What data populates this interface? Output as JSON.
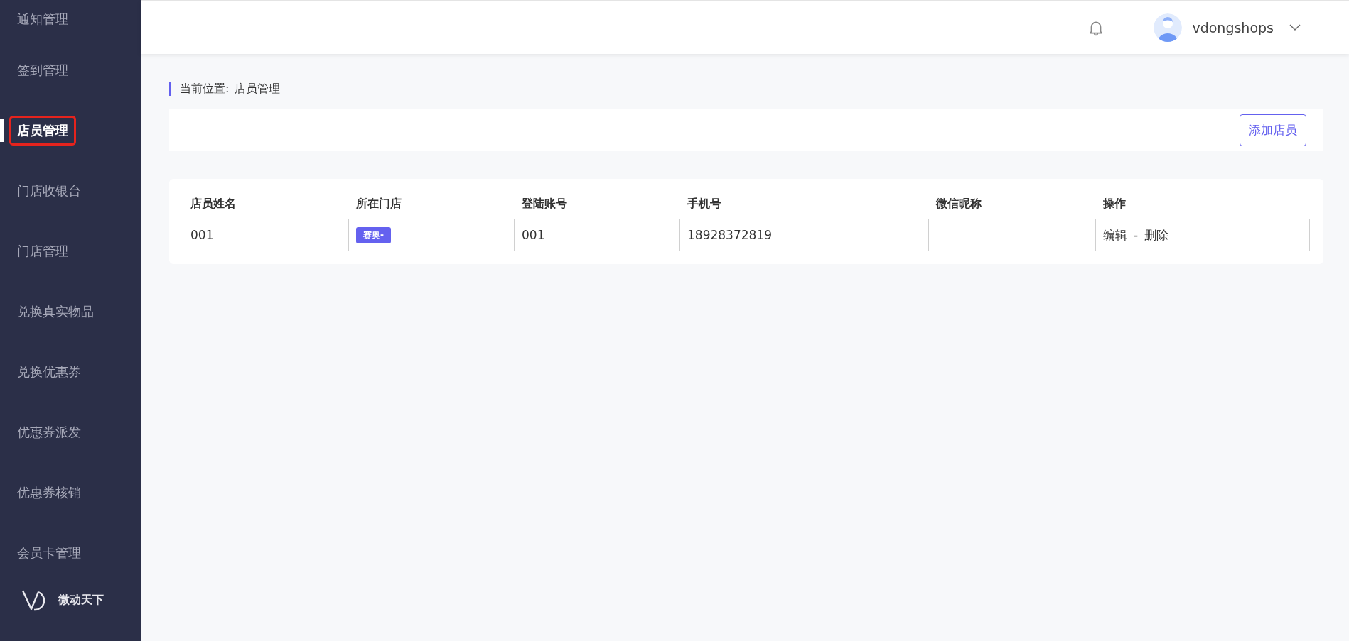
{
  "sidebar": {
    "items": [
      {
        "label": "通知管理",
        "selected": false,
        "highlighted": false
      },
      {
        "label": "签到管理",
        "selected": false,
        "highlighted": false
      },
      {
        "label": "店员管理",
        "selected": true,
        "highlighted": true
      },
      {
        "label": "门店收银台",
        "selected": false,
        "highlighted": false
      },
      {
        "label": "门店管理",
        "selected": false,
        "highlighted": false
      },
      {
        "label": "兑换真实物品",
        "selected": false,
        "highlighted": false
      },
      {
        "label": "兑换优惠券",
        "selected": false,
        "highlighted": false
      },
      {
        "label": "优惠券派发",
        "selected": false,
        "highlighted": false
      },
      {
        "label": "优惠券核销",
        "selected": false,
        "highlighted": false
      },
      {
        "label": "会员卡管理",
        "selected": false,
        "highlighted": false
      }
    ],
    "brand": "微动天下"
  },
  "header": {
    "username": "vdongshops"
  },
  "breadcrumb": {
    "label": "当前位置:",
    "current": "店员管理"
  },
  "toolbar": {
    "button": "添加店员"
  },
  "table": {
    "columns": [
      "店员姓名",
      "所在门店",
      "登陆账号",
      "手机号",
      "微信昵称",
      "操作"
    ],
    "rows": [
      {
        "cells": [
          {
            "kind": "text",
            "text": "001"
          },
          {
            "kind": "tag",
            "text": "赛奥-"
          },
          {
            "kind": "text",
            "text": "001"
          },
          {
            "kind": "text",
            "text": "18928372819"
          },
          {
            "kind": "empty"
          },
          {
            "kind": "actions",
            "links": [
              "编辑",
              "删除"
            ],
            "separator": "-"
          }
        ]
      }
    ]
  }
}
